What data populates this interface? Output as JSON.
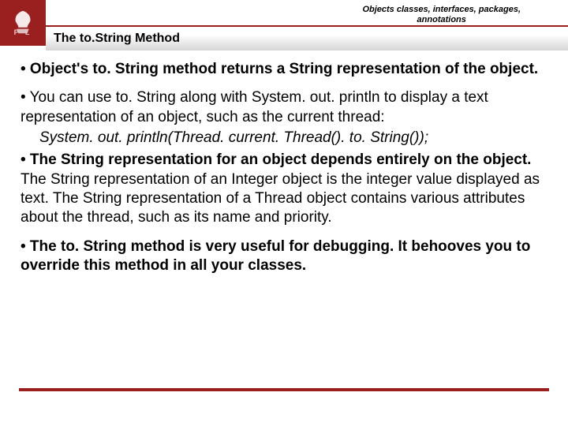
{
  "header": {
    "breadcrumb_line1": "Objects classes, interfaces, packages,",
    "breadcrumb_line2": "annotations",
    "title": "The to.String Method",
    "logo_letters": "P  L"
  },
  "bullets": {
    "b1": "• Object's to. String method returns a String representation of the object.",
    "b2": "• You can use to. String along with System. out. println to display a text representation of an object, such as the current thread:",
    "code": "System. out. println(Thread. current. Thread(). to. String());",
    "b3_lead": "• The String representation for an object depends entirely on the object. ",
    "b3_rest": "The String representation of an Integer object is the integer value displayed as text. The String representation of a Thread object contains various attributes about the thread, such as its name and priority.",
    "b4": "• The to. String method is very useful for debugging. It behooves you to override this method in all your classes."
  }
}
